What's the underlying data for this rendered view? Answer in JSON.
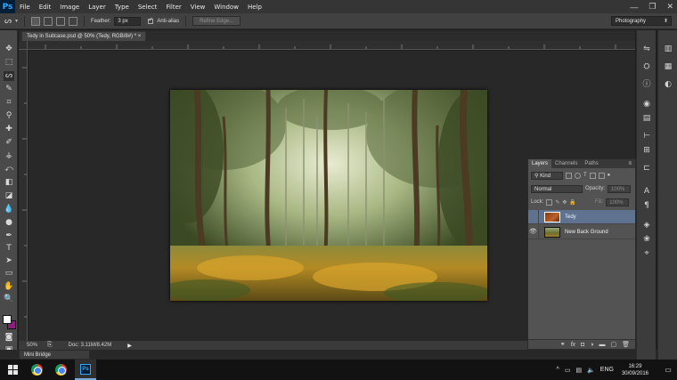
{
  "menubar": {
    "logo": "Ps",
    "items": [
      "File",
      "Edit",
      "Image",
      "Layer",
      "Type",
      "Select",
      "Filter",
      "View",
      "Window",
      "Help"
    ],
    "window_controls": [
      "—",
      "❐",
      "✕"
    ]
  },
  "options": {
    "feather_label": "Feather:",
    "feather_value": "3 px",
    "antialias_label": "Anti-alias",
    "refine_edge_label": "Refine Edge...",
    "workspace": "Photography"
  },
  "document": {
    "tab_title": "Tedy in Suitcase.psd @ 50% (Tedy, RGB/8#) *  ×"
  },
  "status": {
    "zoom": "50%",
    "doc_info": "Doc: 3.11M/8.42M",
    "arrow": "▶"
  },
  "mini_bridge": "Mini Bridge",
  "layers_panel": {
    "tabs": [
      "Layers",
      "Channels",
      "Paths"
    ],
    "filter_label": "Kind",
    "blend_mode": "Normal",
    "opacity_label": "Opacity:",
    "opacity_value": "100%",
    "lock_label": "Lock:",
    "fill_label": "Fill:",
    "fill_value": "100%",
    "layers": [
      {
        "name": "Tedy",
        "visible": false,
        "selected": true
      },
      {
        "name": "New Back Ground",
        "visible": true,
        "selected": false
      }
    ]
  },
  "taskbar": {
    "language": "ENG",
    "time": "16:29",
    "date": "30/09/2016"
  },
  "colors": {
    "foreground": "#ffffff",
    "background": "#8a1f7e",
    "selection": "#5f7391"
  }
}
